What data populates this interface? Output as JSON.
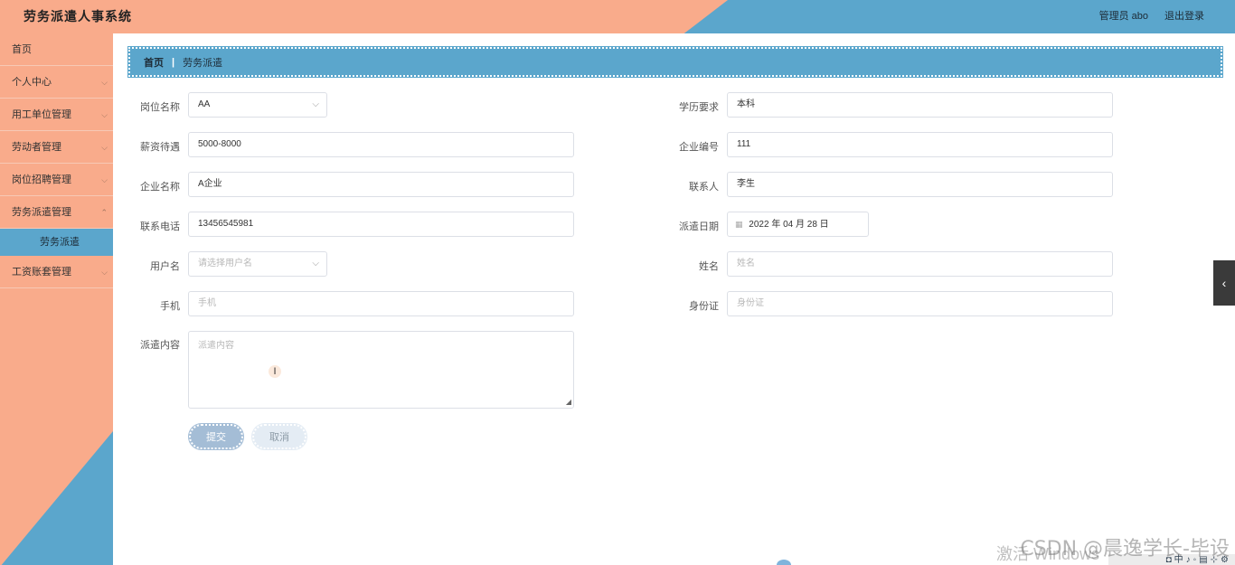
{
  "header": {
    "title": "劳务派遣人事系统",
    "user_label": "管理员 abo",
    "logout_label": "退出登录"
  },
  "sidebar": {
    "items": [
      {
        "label": "首页",
        "has_children": false
      },
      {
        "label": "个人中心",
        "has_children": true
      },
      {
        "label": "用工单位管理",
        "has_children": true
      },
      {
        "label": "劳动者管理",
        "has_children": true
      },
      {
        "label": "岗位招聘管理",
        "has_children": true
      },
      {
        "label": "劳务派遣管理",
        "has_children": true
      },
      {
        "label": "工资账套管理",
        "has_children": true
      }
    ],
    "active_sub": "劳务派遣"
  },
  "breadcrumb": {
    "home": "首页",
    "separator": "|",
    "current": "劳务派遣"
  },
  "form": {
    "post_name": {
      "label": "岗位名称",
      "value": "AA"
    },
    "education": {
      "label": "学历要求",
      "value": "本科"
    },
    "salary": {
      "label": "薪资待遇",
      "value": "5000-8000"
    },
    "company_no": {
      "label": "企业编号",
      "value": "111"
    },
    "company_name": {
      "label": "企业名称",
      "value": "A企业"
    },
    "contact": {
      "label": "联系人",
      "value": "李生"
    },
    "phone": {
      "label": "联系电话",
      "value": "13456545981"
    },
    "dispatch_date": {
      "label": "派遣日期",
      "value": "2022 年 04 月 28 日"
    },
    "username": {
      "label": "用户名",
      "placeholder": "请选择用户名"
    },
    "name": {
      "label": "姓名",
      "placeholder": "姓名"
    },
    "mobile": {
      "label": "手机",
      "placeholder": "手机"
    },
    "id_card": {
      "label": "身份证",
      "placeholder": "身份证"
    },
    "content": {
      "label": "派遣内容",
      "placeholder": "派遣内容"
    },
    "submit_label": "提交",
    "cancel_label": "取消"
  },
  "overlay": {
    "watermark": "CSDN @晨逸学长-毕设",
    "activate": "激活 Windows"
  },
  "colors": {
    "salmon": "#f9ab8b",
    "blue": "#5ba6cc"
  }
}
